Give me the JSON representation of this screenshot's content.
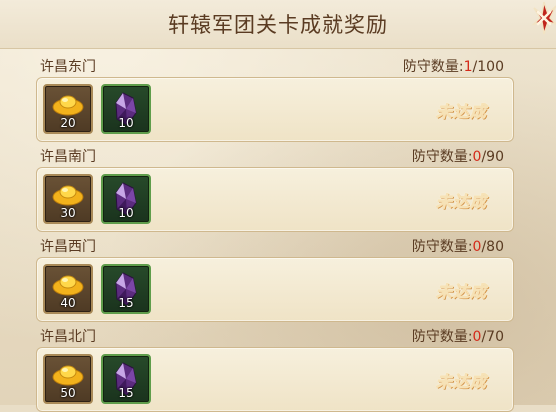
{
  "title": "轩辕军团关卡成就奖励",
  "close": {
    "icon": "close-x-icon"
  },
  "colors": {
    "title_text": "#5a3b22",
    "current_count": "#d42a1a",
    "status_text": "#f0a440",
    "gold_frame": "#a98a58",
    "crystal_frame": "#5f9d4b"
  },
  "defense_label": "防守数量:",
  "sections": [
    {
      "name": "许昌东门",
      "current": "1",
      "total": "/100",
      "status": "未达成",
      "rewards": [
        {
          "icon": "gold-ingot-icon",
          "qty": "20"
        },
        {
          "icon": "purple-crystal-icon",
          "qty": "10"
        }
      ]
    },
    {
      "name": "许昌南门",
      "current": "0",
      "total": "/90",
      "status": "未达成",
      "rewards": [
        {
          "icon": "gold-ingot-icon",
          "qty": "30"
        },
        {
          "icon": "purple-crystal-icon",
          "qty": "10"
        }
      ]
    },
    {
      "name": "许昌西门",
      "current": "0",
      "total": "/80",
      "status": "未达成",
      "rewards": [
        {
          "icon": "gold-ingot-icon",
          "qty": "40"
        },
        {
          "icon": "purple-crystal-icon",
          "qty": "15"
        }
      ]
    },
    {
      "name": "许昌北门",
      "current": "0",
      "total": "/70",
      "status": "未达成",
      "rewards": [
        {
          "icon": "gold-ingot-icon",
          "qty": "50"
        },
        {
          "icon": "purple-crystal-icon",
          "qty": "15"
        }
      ]
    }
  ]
}
